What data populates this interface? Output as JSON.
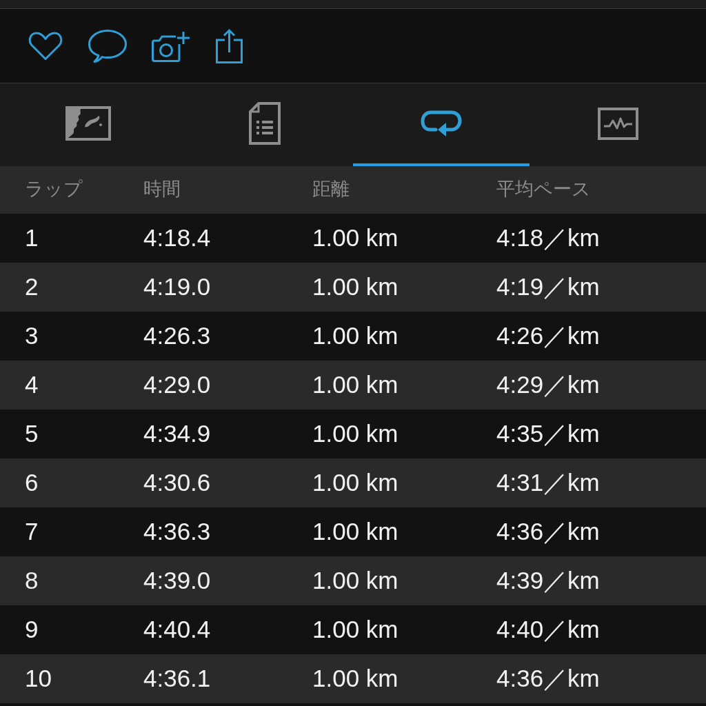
{
  "actions": [
    {
      "kind": "like"
    },
    {
      "kind": "comment"
    },
    {
      "kind": "photo"
    },
    {
      "kind": "share"
    }
  ],
  "tabs": [
    {
      "kind": "map",
      "selected": false
    },
    {
      "kind": "details",
      "selected": false
    },
    {
      "kind": "laps",
      "selected": true
    },
    {
      "kind": "charts",
      "selected": false
    }
  ],
  "table": {
    "columns": [
      "ラップ",
      "時間",
      "距離",
      "平均ペース"
    ],
    "rows": [
      [
        "1",
        "4:18.4",
        "1.00 km",
        "4:18／km"
      ],
      [
        "2",
        "4:19.0",
        "1.00 km",
        "4:19／km"
      ],
      [
        "3",
        "4:26.3",
        "1.00 km",
        "4:26／km"
      ],
      [
        "4",
        "4:29.0",
        "1.00 km",
        "4:29／km"
      ],
      [
        "5",
        "4:34.9",
        "1.00 km",
        "4:35／km"
      ],
      [
        "6",
        "4:30.6",
        "1.00 km",
        "4:31／km"
      ],
      [
        "7",
        "4:36.3",
        "1.00 km",
        "4:36／km"
      ],
      [
        "8",
        "4:39.0",
        "1.00 km",
        "4:39／km"
      ],
      [
        "9",
        "4:40.4",
        "1.00 km",
        "4:40／km"
      ],
      [
        "10",
        "4:36.1",
        "1.00 km",
        "4:36／km"
      ]
    ]
  }
}
